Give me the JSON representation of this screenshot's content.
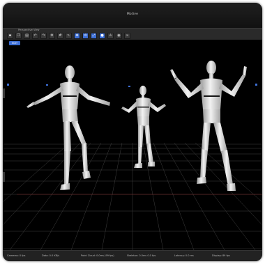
{
  "window": {
    "title": "Motive"
  },
  "toolbar": {
    "view_label": "Perspective View",
    "buttons": [
      "camera-icon",
      "copy-icon",
      "save-icon",
      "undo-icon",
      "redo-icon",
      "settings-icon",
      "grid-icon",
      "select-icon",
      "move-icon",
      "rotate-icon",
      "scale-icon",
      "marker-icon",
      "skeleton-icon",
      "eye-icon",
      "link-icon"
    ]
  },
  "viewport": {
    "badge": "EDIT",
    "scene": "three posed mannequin figures on a grid floor"
  },
  "statusbar": {
    "items": [
      "Cameras: 0 fps",
      "Data: 0.0 KB/s",
      "Point Cloud: 0.0ms (99 fps)",
      "Skeleton: 0.0ms 0.0 fps",
      "Latency: 0.0 ms",
      "Display: 89 fps"
    ]
  },
  "colors": {
    "accent": "#3d6fd6",
    "background": "#000000",
    "chrome": "#1b1b1b"
  }
}
